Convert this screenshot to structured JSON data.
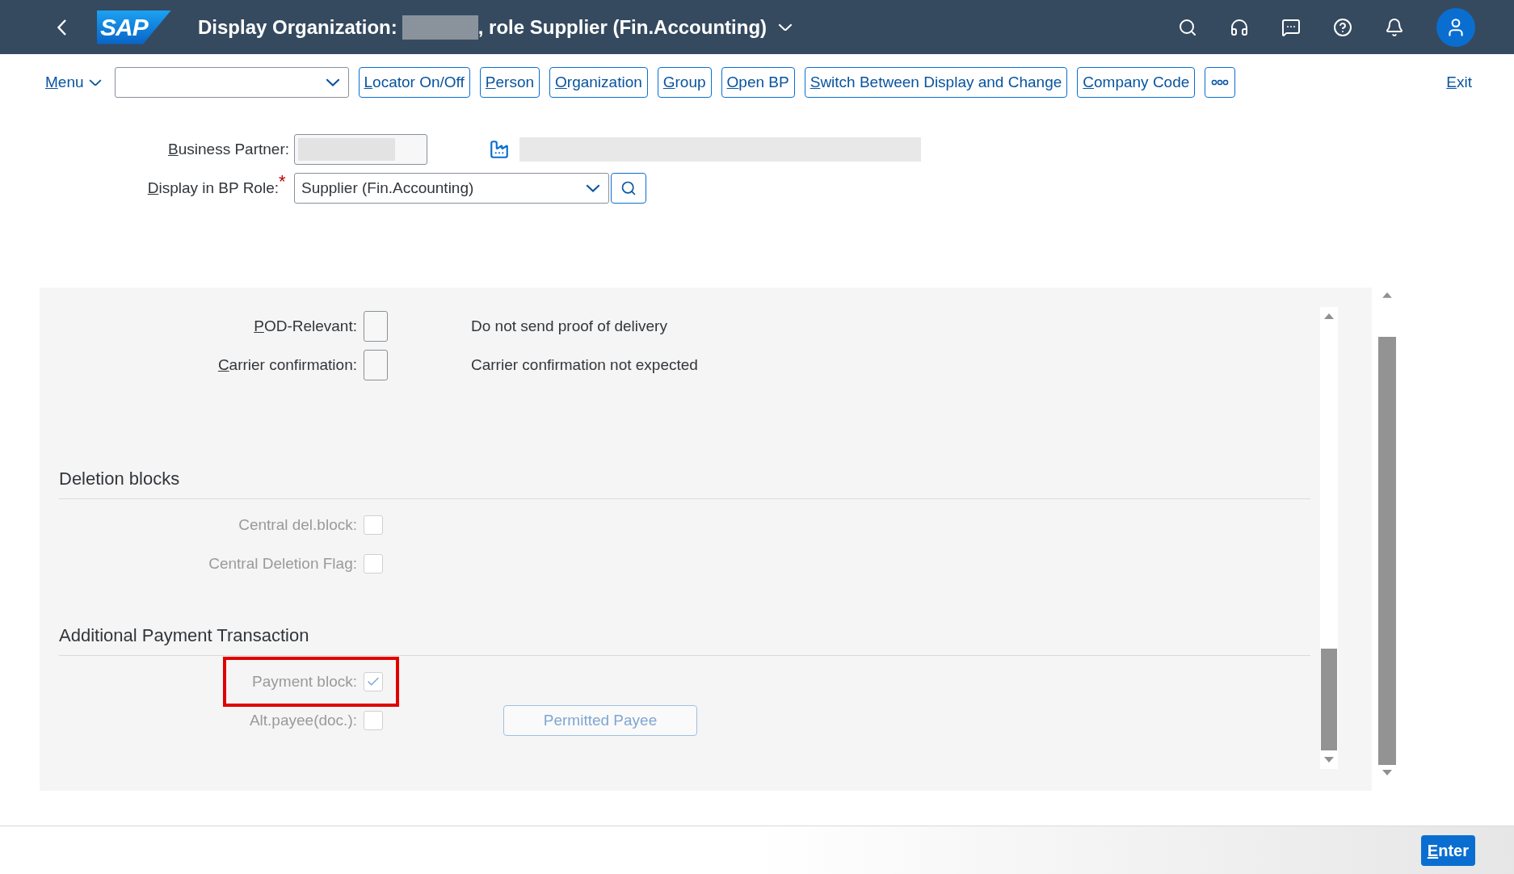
{
  "header": {
    "logo": "SAP",
    "title_prefix": "Display Organization:",
    "title_suffix": ", role Supplier (Fin.Accounting)"
  },
  "toolbar": {
    "menu": {
      "label": "Menu",
      "mnemonic": true
    },
    "buttons": [
      {
        "label": "Locator On/Off",
        "mnemonic": true
      },
      {
        "label": "Person",
        "mnemonic": true
      },
      {
        "label": "Organization",
        "mnemonic": true
      },
      {
        "label": "Group",
        "mnemonic": true
      },
      {
        "label": "Open BP",
        "mnemonic": true
      },
      {
        "label": "Switch Between Display and Change",
        "mnemonic": true
      },
      {
        "label": "Company Code",
        "mnemonic": true
      }
    ],
    "exit": {
      "label": "Exit",
      "mnemonic": true
    }
  },
  "business_partner": {
    "label": "Business Partner:",
    "mnemonic": true
  },
  "role": {
    "label": "Display in BP Role:",
    "mnemonic": true,
    "required_mark": "*",
    "value": "Supplier (Fin.Accounting)"
  },
  "sections": [
    {
      "fields": [
        {
          "kind": "flag",
          "label": "POD-Relevant:",
          "mnemonic": true,
          "disabled": false,
          "checked": false,
          "highlighted": false,
          "description": "Do not send proof of delivery"
        },
        {
          "kind": "flag",
          "label": "Carrier confirmation:",
          "mnemonic": true,
          "disabled": false,
          "checked": false,
          "highlighted": false,
          "description": "Carrier confirmation not expected"
        }
      ]
    },
    {
      "title": "Deletion blocks",
      "fields": [
        {
          "kind": "checkbox",
          "label": "Central del.block:",
          "mnemonic": false,
          "disabled": true,
          "checked": false,
          "highlighted": false
        },
        {
          "kind": "checkbox",
          "label": "Central Deletion Flag:",
          "mnemonic": false,
          "disabled": true,
          "checked": false,
          "highlighted": false
        }
      ]
    },
    {
      "title": "Additional Payment Transaction",
      "fields": [
        {
          "kind": "checkbox",
          "label": "Payment block:",
          "mnemonic": false,
          "disabled": true,
          "checked": true,
          "highlighted": true
        },
        {
          "kind": "checkbox",
          "label": "Alt.payee(doc.):",
          "mnemonic": false,
          "disabled": true,
          "checked": false,
          "highlighted": false,
          "button": {
            "label": "Permitted Payee",
            "disabled": true
          }
        }
      ]
    }
  ],
  "footer": {
    "enter": {
      "label": "Enter",
      "mnemonic": true
    }
  }
}
